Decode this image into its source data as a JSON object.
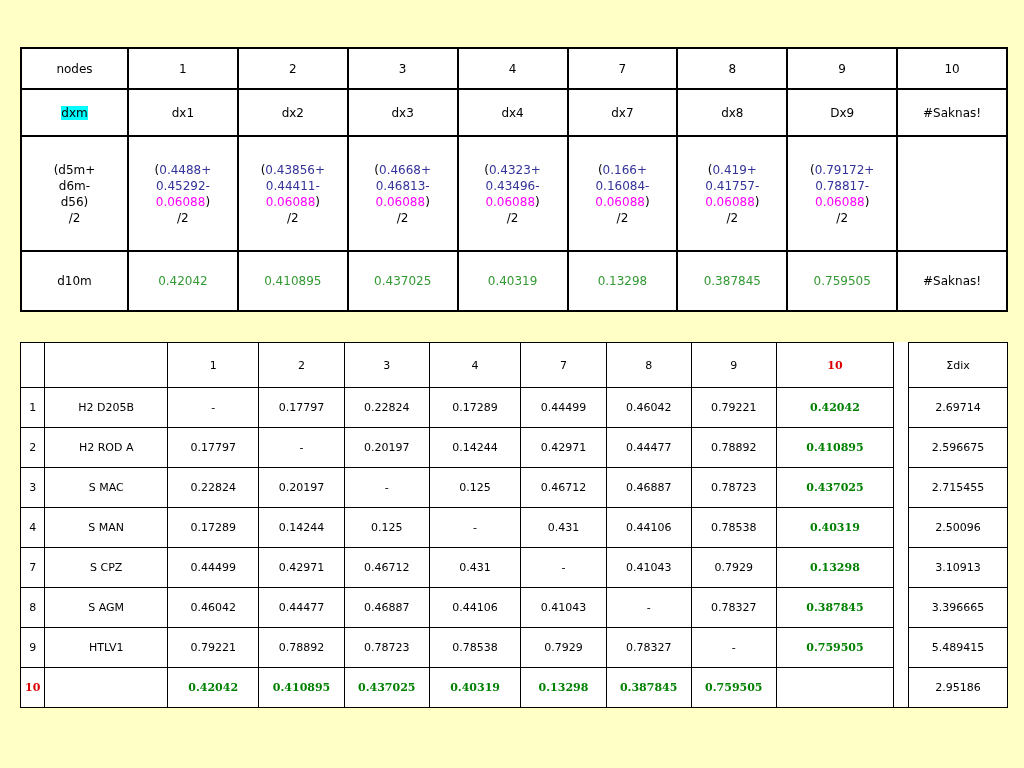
{
  "top_table": {
    "header": {
      "label": "nodes",
      "cells": [
        "1",
        "2",
        "3",
        "4",
        "7",
        "8",
        "9",
        "10"
      ]
    },
    "label_row": {
      "label": "dxm",
      "label_highlighted": true,
      "cells": [
        "dx1",
        "dx2",
        "dx3",
        "dx4",
        "dx7",
        "dx8",
        "Dx9",
        "#Saknas!"
      ]
    },
    "formula_row": {
      "label_lines": [
        "(d5m+",
        "d6m-",
        "d56)",
        "/2"
      ],
      "cells": [
        [
          [
            {
              "text": "("
            },
            {
              "text": "0.4488+",
              "color": "#333399"
            }
          ],
          [
            {
              "text": "0.45292-",
              "color": "#333399"
            }
          ],
          [
            {
              "text": "0.06088",
              "color": "#ff00ff"
            },
            {
              "text": ")"
            }
          ],
          [
            {
              "text": "/2"
            }
          ]
        ],
        [
          [
            {
              "text": "("
            },
            {
              "text": "0.43856+",
              "color": "#333399"
            }
          ],
          [
            {
              "text": "0.44411-",
              "color": "#333399"
            }
          ],
          [
            {
              "text": "0.06088",
              "color": "#ff00ff"
            },
            {
              "text": ")"
            }
          ],
          [
            {
              "text": "/2"
            }
          ]
        ],
        [
          [
            {
              "text": "("
            },
            {
              "text": "0.4668+",
              "color": "#333399"
            }
          ],
          [
            {
              "text": "0.46813-",
              "color": "#333399"
            }
          ],
          [
            {
              "text": "0.06088",
              "color": "#ff00ff"
            },
            {
              "text": ")"
            }
          ],
          [
            {
              "text": "/2"
            }
          ]
        ],
        [
          [
            {
              "text": "("
            },
            {
              "text": "0.4323+",
              "color": "#333399"
            }
          ],
          [
            {
              "text": "0.43496-",
              "color": "#333399"
            }
          ],
          [
            {
              "text": "0.06088",
              "color": "#ff00ff"
            },
            {
              "text": ")"
            }
          ],
          [
            {
              "text": "/2"
            }
          ]
        ],
        [
          [
            {
              "text": "("
            },
            {
              "text": "0.166+",
              "color": "#333399"
            }
          ],
          [
            {
              "text": "0.16084-",
              "color": "#333399"
            }
          ],
          [
            {
              "text": "0.06088",
              "color": "#ff00ff"
            },
            {
              "text": ")"
            }
          ],
          [
            {
              "text": "/2"
            }
          ]
        ],
        [
          [
            {
              "text": "("
            },
            {
              "text": "0.419+",
              "color": "#333399"
            }
          ],
          [
            {
              "text": "0.41757-",
              "color": "#333399"
            }
          ],
          [
            {
              "text": "0.06088",
              "color": "#ff00ff"
            },
            {
              "text": ")"
            }
          ],
          [
            {
              "text": "/2"
            }
          ]
        ],
        [
          [
            {
              "text": "("
            },
            {
              "text": "0.79172+",
              "color": "#333399"
            }
          ],
          [
            {
              "text": "0.78817-",
              "color": "#333399"
            }
          ],
          [
            {
              "text": "0.06088",
              "color": "#ff00ff"
            },
            {
              "text": ")"
            }
          ],
          [
            {
              "text": "/2"
            }
          ]
        ]
      ]
    },
    "result_row": {
      "label": "d10m",
      "cells": [
        {
          "text": "0.42042",
          "kind": "value"
        },
        {
          "text": "0.410895",
          "kind": "value"
        },
        {
          "text": "0.437025",
          "kind": "value"
        },
        {
          "text": "0.40319",
          "kind": "value"
        },
        {
          "text": "0.13298",
          "kind": "value"
        },
        {
          "text": "0.387845",
          "kind": "value"
        },
        {
          "text": "0.759505",
          "kind": "value"
        },
        {
          "text": "#Saknas!",
          "kind": "error"
        }
      ]
    }
  },
  "matrix": {
    "columns": [
      {
        "label": "1",
        "highlighted": false
      },
      {
        "label": "2",
        "highlighted": false
      },
      {
        "label": "3",
        "highlighted": false
      },
      {
        "label": "4",
        "highlighted": false
      },
      {
        "label": "7",
        "highlighted": false
      },
      {
        "label": "8",
        "highlighted": false
      },
      {
        "label": "9",
        "highlighted": false
      },
      {
        "label": "10",
        "highlighted": true
      }
    ],
    "sum_label": "Σdix",
    "rows": [
      {
        "index": "1",
        "name": "H2 D205B",
        "highlighted": false,
        "values": [
          "-",
          "0.17797",
          "0.22824",
          "0.17289",
          "0.44499",
          "0.46042",
          "0.79221",
          "0.42042"
        ],
        "sum": "2.69714"
      },
      {
        "index": "2",
        "name": "H2 ROD A",
        "highlighted": false,
        "values": [
          "0.17797",
          "-",
          "0.20197",
          "0.14244",
          "0.42971",
          "0.44477",
          "0.78892",
          "0.410895"
        ],
        "sum": "2.596675"
      },
      {
        "index": "3",
        "name": "S MAC",
        "highlighted": false,
        "values": [
          "0.22824",
          "0.20197",
          "-",
          "0.125",
          "0.46712",
          "0.46887",
          "0.78723",
          "0.437025"
        ],
        "sum": "2.715455"
      },
      {
        "index": "4",
        "name": "S MAN",
        "highlighted": false,
        "values": [
          "0.17289",
          "0.14244",
          "0.125",
          "-",
          "0.431",
          "0.44106",
          "0.78538",
          "0.40319"
        ],
        "sum": "2.50096"
      },
      {
        "index": "7",
        "name": "S CPZ",
        "highlighted": false,
        "values": [
          "0.44499",
          "0.42971",
          "0.46712",
          "0.431",
          "-",
          "0.41043",
          "0.7929",
          "0.13298"
        ],
        "sum": "3.10913"
      },
      {
        "index": "8",
        "name": "S AGM",
        "highlighted": false,
        "values": [
          "0.46042",
          "0.44477",
          "0.46887",
          "0.44106",
          "0.41043",
          "-",
          "0.78327",
          "0.387845"
        ],
        "sum": "3.396665"
      },
      {
        "index": "9",
        "name": "HTLV1",
        "highlighted": false,
        "values": [
          "0.79221",
          "0.78892",
          "0.78723",
          "0.78538",
          "0.7929",
          "0.78327",
          "-",
          "0.759505"
        ],
        "sum": "5.489415"
      },
      {
        "index": "10",
        "highlighted": true,
        "values": [
          "0.42042",
          "0.410895",
          "0.437025",
          "0.40319",
          "0.13298",
          "0.387845",
          "0.759505"
        ],
        "sum": "2.95186"
      }
    ]
  }
}
